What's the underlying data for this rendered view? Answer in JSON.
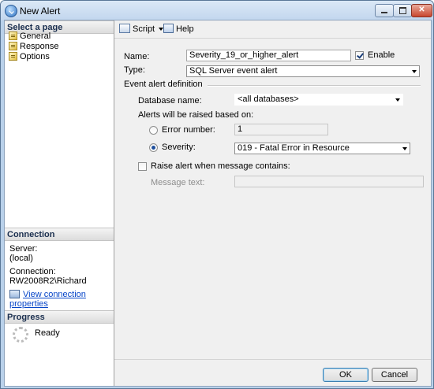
{
  "window": {
    "title": "New Alert",
    "minimize_glyph": "",
    "close_glyph": "✕"
  },
  "sidebar": {
    "select_page_header": "Select a page",
    "pages": [
      {
        "label": "General"
      },
      {
        "label": "Response"
      },
      {
        "label": "Options"
      }
    ],
    "connection_header": "Connection",
    "server_label": "Server:",
    "server_value": "(local)",
    "connection_label": "Connection:",
    "connection_value": "RW2008R2\\Richard",
    "view_connection_link": "View connection properties",
    "progress_header": "Progress",
    "progress_status": "Ready"
  },
  "toolbar": {
    "script_label": "Script",
    "help_label": "Help"
  },
  "form": {
    "name_label": "Name:",
    "name_value": "Severity_19_or_higher_alert",
    "enable_label": "Enable",
    "enable_checked": true,
    "type_label": "Type:",
    "type_value": "SQL Server event alert",
    "event_def_label": "Event alert definition",
    "database_label": "Database name:",
    "database_value": "<all databases>",
    "raised_label": "Alerts will be raised based on:",
    "error_number_label": "Error number:",
    "error_number_value": "1",
    "severity_label": "Severity:",
    "severity_value": "019 - Fatal Error in Resource",
    "selected_option": "severity",
    "raise_msg_label": "Raise alert when message contains:",
    "raise_msg_checked": false,
    "message_text_label": "Message text:",
    "message_text_value": ""
  },
  "buttons": {
    "ok_label": "OK",
    "cancel_label": "Cancel"
  }
}
